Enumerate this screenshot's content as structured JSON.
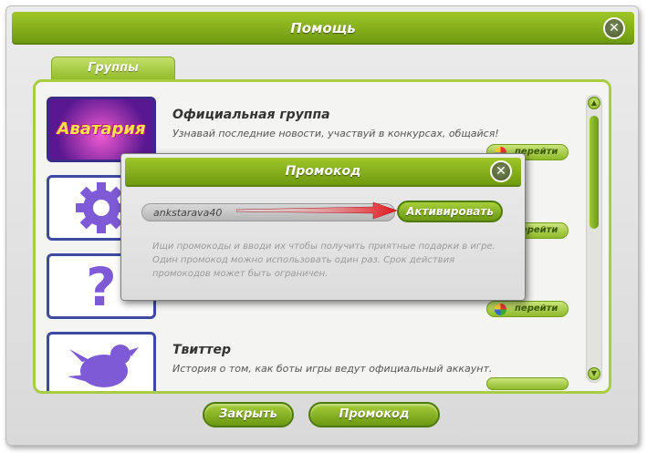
{
  "window": {
    "title": "Помощь",
    "close_symbol": "✕"
  },
  "tabs": [
    {
      "label": "Группы"
    }
  ],
  "groups": [
    {
      "thumb_text": "Аватария",
      "title": "Официальная группа",
      "description": "Узнавай последние новости, участвуй в конкурсах, общайся!",
      "go_label": "перейти"
    },
    {
      "title": "",
      "description": "",
      "go_label": "перейти"
    },
    {
      "title": "",
      "description": "",
      "go_label": "перейти"
    },
    {
      "title": "Твиттер",
      "description": "История о том, как боты игры ведут официальный аккаунт.",
      "go_label": ""
    }
  ],
  "footer": {
    "close_label": "Закрыть",
    "promo_label": "Промокод"
  },
  "promo_dialog": {
    "title": "Промокод",
    "close_symbol": "✕",
    "input_value": "ankstarava40",
    "activate_label": "Активировать",
    "hint": "Ищи промокоды и вводи их чтобы получить приятные подарки в игре. Один промокод можно использовать один раз. Срок действия промокодов может быть ограничен."
  },
  "colors": {
    "accent_green": "#8fba2a",
    "arrow_red": "#e0151b"
  },
  "icons": [
    "close-icon",
    "gear-icon",
    "question-icon",
    "twitter-bird-icon",
    "globe-icon",
    "scroll-up-icon",
    "scroll-down-icon",
    "arrow-icon"
  ]
}
